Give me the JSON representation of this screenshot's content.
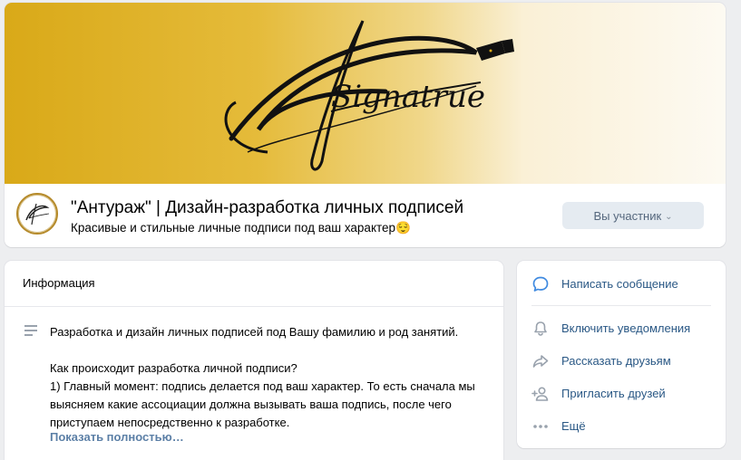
{
  "cover": {
    "logo_text": "Signatrue"
  },
  "group": {
    "name": "\"Антураж\" | Дизайн-разработка личных подписей",
    "status": "Красивые и стильные личные подписи под ваш характер😌",
    "member_button": "Вы участник",
    "member_chevron": "⌄"
  },
  "info": {
    "title": "Информация",
    "description": "Разработка и дизайн личных подписей под Вашу фамилию и род занятий.\n\nКак происходит разработка личной подписи?\n1) Главный момент: подпись делается под ваш характер. То есть сначала мы выясняем какие ассоциации должна вызывать ваша подпись, после чего приступаем непосредственно к разработке.",
    "show_more": "Показать полностью…"
  },
  "actions": {
    "message": "Написать сообщение",
    "notifications": "Включить уведомления",
    "share": "Рассказать друзьям",
    "invite": "Пригласить друзей",
    "more": "Ещё"
  },
  "colors": {
    "accent": "#2a5885",
    "icon": "#99a2ad",
    "primary_icon": "#3f8ae0",
    "cover_gold": "#d9a918"
  }
}
